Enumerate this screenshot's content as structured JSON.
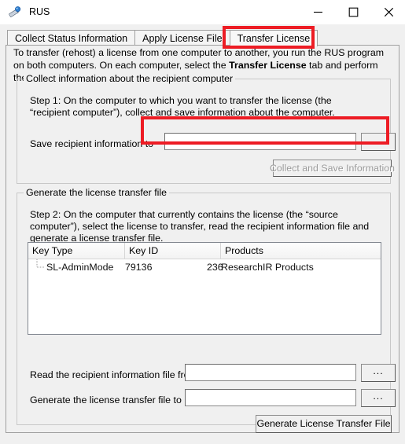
{
  "window": {
    "title": "RUS",
    "icon": "license-key-icon",
    "controls": {
      "minimize": "minimize-icon",
      "maximize": "maximize-icon",
      "close": "close-icon"
    }
  },
  "tabs": [
    {
      "label": "Collect Status Information",
      "selected": false
    },
    {
      "label": "Apply License File",
      "selected": false
    },
    {
      "label": "Transfer License",
      "selected": true
    }
  ],
  "panel": {
    "intro_part1": "To transfer (rehost) a license from one computer to another, you run the RUS program on both computers. On each computer, select the ",
    "intro_bold": "Transfer License",
    "intro_part2": " tab and perform the appropriate step."
  },
  "collect_group": {
    "title": "Collect information about the recipient computer",
    "step_text": "Step 1: On the computer to which you want to transfer the license (the “recipient computer”), collect and save information about the computer.",
    "save_label": "Save recipient information to",
    "save_value": "",
    "save_placeholder": "",
    "browse_label": "...",
    "collect_button_label": "Collect and Save Information",
    "collect_button_enabled": false
  },
  "generate_group": {
    "title": "Generate the license transfer file",
    "step_text": "Step 2: On the computer that currently contains the license (the “source computer”), select the license to transfer, read the recipient information file and generate a license transfer file.",
    "list": {
      "columns": [
        "Key Type",
        "Key ID",
        "Products"
      ],
      "rows": [
        {
          "key_type": "SL-AdminMode",
          "key_id_prefix": "79136",
          "key_id_suffix": "236",
          "products": "ResearchIR Products"
        }
      ]
    },
    "read_label": "Read the recipient information file from",
    "read_value": "",
    "read_browse_label": "...",
    "generate_label": "Generate the license transfer file to",
    "generate_value": "",
    "generate_browse_label": "...",
    "generate_button_label": "Generate License Transfer File"
  },
  "annotations": {
    "color": "#ed1c24",
    "targets": [
      "transfer-license-tab",
      "save-recipient-information-field"
    ]
  }
}
